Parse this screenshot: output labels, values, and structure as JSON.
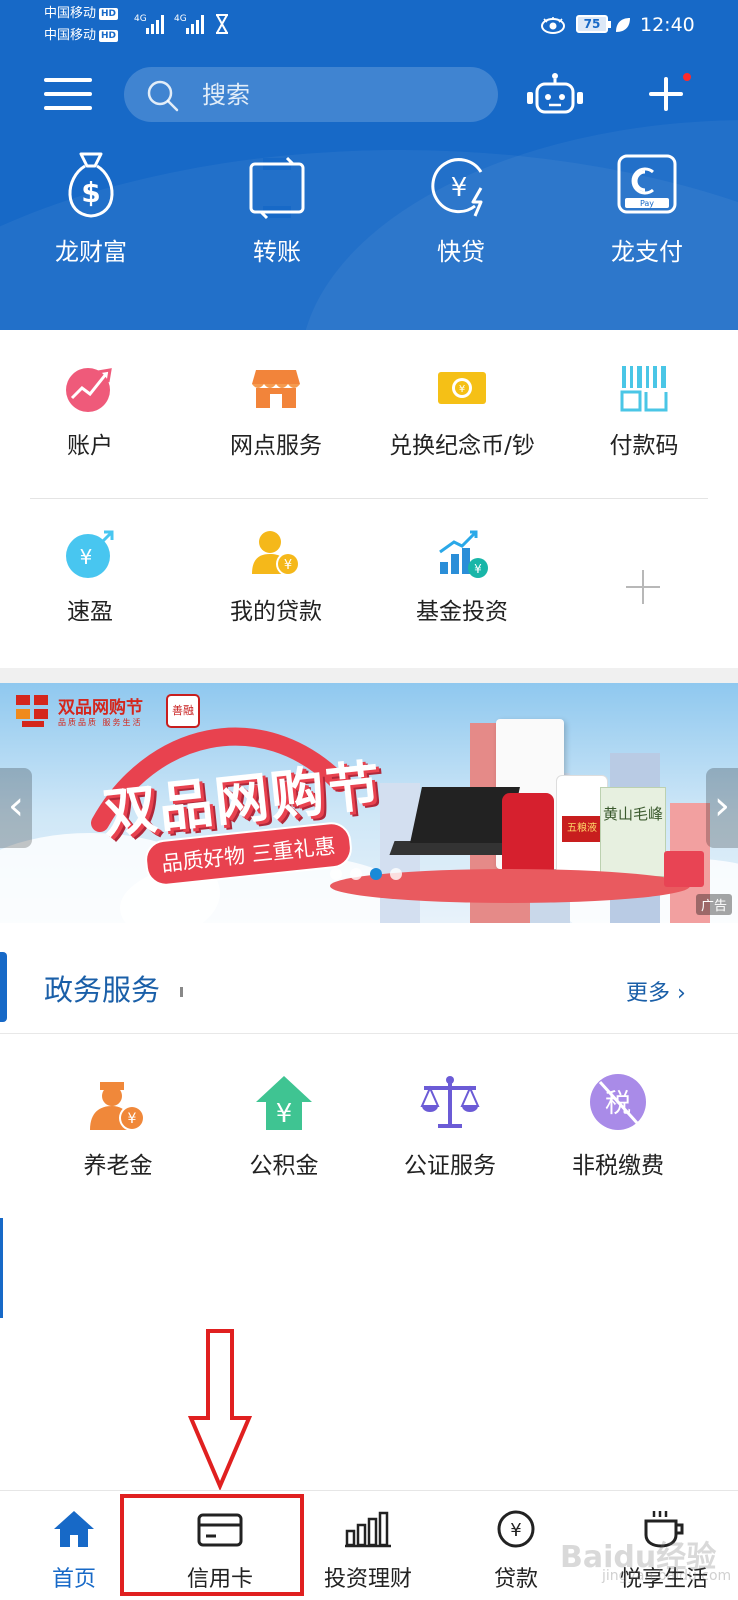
{
  "status_bar": {
    "carrier1": "中国移动",
    "carrier2": "中国移动",
    "hd_badge": "HD",
    "network": "4G",
    "battery": "75",
    "time": "12:40"
  },
  "header": {
    "search_placeholder": "搜索",
    "quick_actions": [
      {
        "label": "龙财富",
        "icon": "money-bag-icon"
      },
      {
        "label": "转账",
        "icon": "transfer-icon"
      },
      {
        "label": "快贷",
        "icon": "quick-loan-icon"
      },
      {
        "label": "龙支付",
        "icon": "pay-icon"
      }
    ]
  },
  "services": [
    {
      "label": "账户",
      "icon": "account-chart-icon"
    },
    {
      "label": "网点服务",
      "icon": "branch-store-icon"
    },
    {
      "label": "兑换纪念币/钞",
      "icon": "coin-exchange-icon"
    },
    {
      "label": "付款码",
      "icon": "payment-code-icon"
    },
    {
      "label": "速盈",
      "icon": "quick-profit-icon"
    },
    {
      "label": "我的贷款",
      "icon": "my-loan-icon"
    },
    {
      "label": "基金投资",
      "icon": "fund-investment-icon"
    }
  ],
  "banner": {
    "brand": "双品网购节",
    "brand_sub": "品质品质 服务生活",
    "seal": "善融",
    "title": "双品网购节",
    "subtitle": "品质好物 三重礼惠",
    "book_text": "黄山毛峰",
    "bottle_text": "五粮液",
    "ad_label": "广告"
  },
  "government": {
    "title": "政务服务",
    "more_label": "更多 ›",
    "items": [
      {
        "label": "养老金",
        "icon": "pension-icon",
        "color": "#f0883a"
      },
      {
        "label": "公积金",
        "icon": "housing-fund-icon",
        "color": "#3fc492"
      },
      {
        "label": "公证服务",
        "icon": "scale-icon",
        "color": "#6b5bd6"
      },
      {
        "label": "非税缴费",
        "icon": "non-tax-icon",
        "color": "#9b7ee6"
      }
    ],
    "tax_char": "税"
  },
  "tabbar": {
    "tabs": [
      {
        "label": "首页",
        "icon": "home-icon",
        "active": true
      },
      {
        "label": "信用卡",
        "icon": "credit-card-icon",
        "active": false
      },
      {
        "label": "投资理财",
        "icon": "bar-chart-icon",
        "active": false
      },
      {
        "label": "贷款",
        "icon": "yuan-coin-icon",
        "active": false
      },
      {
        "label": "悦享生活",
        "icon": "coffee-cup-icon",
        "active": false
      }
    ]
  },
  "watermark": {
    "text": "Baidu经验",
    "sub": "jingyan.baidu.com"
  },
  "colors": {
    "brand_blue": "#1769c7",
    "annotation_red": "#e02020"
  }
}
